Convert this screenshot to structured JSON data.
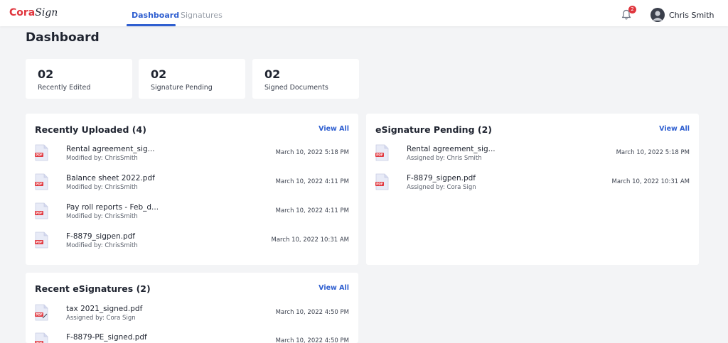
{
  "app": {
    "logo_primary": "Cora",
    "logo_secondary": "Sign"
  },
  "nav": {
    "tabs": [
      {
        "label": "Dashboard",
        "active": true
      },
      {
        "label": "Signatures",
        "active": false
      }
    ]
  },
  "header": {
    "notification_count": "2",
    "user_name": "Chris Smith"
  },
  "page": {
    "title": "Dashboard"
  },
  "stats": [
    {
      "value": "02",
      "label": "Recently Edited"
    },
    {
      "value": "02",
      "label": "Signature Pending"
    },
    {
      "value": "02",
      "label": "Signed Documents"
    }
  ],
  "recently_uploaded": {
    "title": "Recently Uploaded (4)",
    "view_all": "View All",
    "items": [
      {
        "name": "Rental agreement_sig...",
        "sub": "Modified by: ChrisSmith",
        "date": "March 10, 2022 5:18 PM"
      },
      {
        "name": "Balance sheet 2022.pdf",
        "sub": "Modified by: ChrisSmith",
        "date": "March 10, 2022 4:11 PM"
      },
      {
        "name": "Pay roll reports - Feb_d...",
        "sub": "Modified by: ChrisSmith",
        "date": "March 10, 2022 4:11 PM"
      },
      {
        "name": "F-8879_sigpen.pdf",
        "sub": "Modified by: ChrisSmith",
        "date": "March 10, 2022 10:31 AM"
      }
    ]
  },
  "esignature_pending": {
    "title": "eSignature Pending (2)",
    "view_all": "View All",
    "items": [
      {
        "name": "Rental agreement_sig...",
        "sub": "Assigned by: Chris Smith",
        "date": "March 10, 2022 5:18 PM"
      },
      {
        "name": "F-8879_sigpen.pdf",
        "sub": "Assigned by: Cora Sign",
        "date": "March 10, 2022 10:31 AM"
      }
    ]
  },
  "recent_esignatures": {
    "title": "Recent eSignatures (2)",
    "view_all": "View All",
    "items": [
      {
        "name": "tax 2021_signed.pdf",
        "sub": "Assigned by: Cora Sign",
        "date": "March 10, 2022 4:50 PM"
      },
      {
        "name": "F-8879-PE_signed.pdf",
        "sub": "",
        "date": "March 10, 2022 4:50 PM"
      }
    ]
  },
  "colors": {
    "accent": "#2f5fd0",
    "brand": "#e0353d",
    "background": "#f3f4f6"
  },
  "icons": {
    "file": "pdf-file-icon",
    "signed_file": "signed-pdf-icon",
    "notification": "bell-icon",
    "avatar": "user-avatar-icon"
  }
}
